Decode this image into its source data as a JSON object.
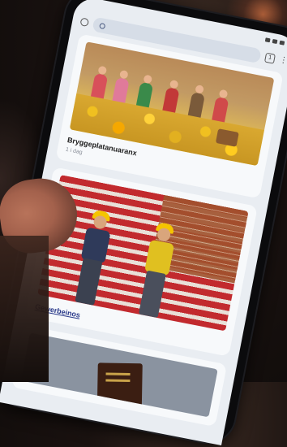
{
  "browser": {
    "tab_count": "1",
    "menu_glyph": "⋮"
  },
  "feed": {
    "cards": [
      {
        "caption": "Bryggeplatanuaranx",
        "meta": "1 i dag"
      },
      {
        "link": "Gewerbeinos"
      },
      {}
    ]
  },
  "colors": {
    "screen_bg": "#e9edf2",
    "link": "#2a3a8a",
    "helmet": "#f5c400",
    "stripes": "#c22a2e"
  }
}
